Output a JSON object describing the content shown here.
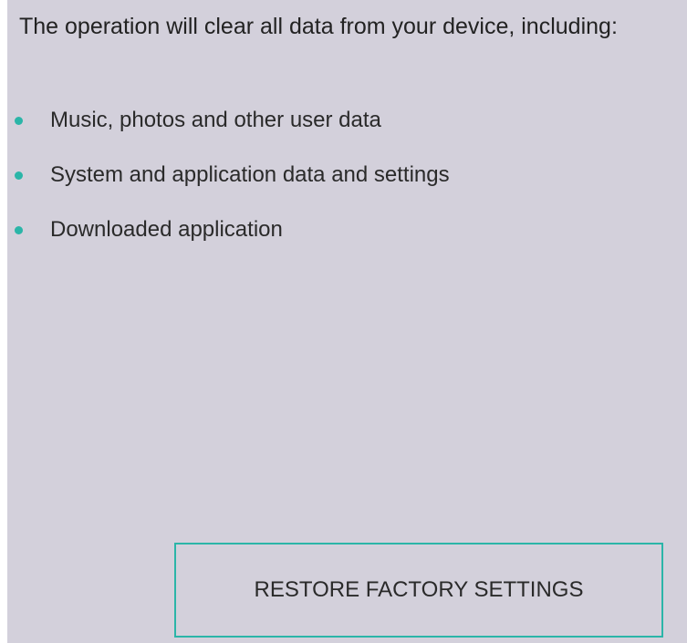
{
  "message": "The operation will clear all data from your device, including:",
  "items": [
    {
      "label": "Music, photos and other user data",
      "icon": "bullet-dot-icon"
    },
    {
      "label": "System and application data and settings",
      "icon": "bullet-dot-icon"
    },
    {
      "label": "Downloaded application",
      "icon": "bullet-dot-icon"
    }
  ],
  "restore_button": {
    "label": "RESTORE FACTORY SETTINGS"
  },
  "colors": {
    "background": "#d3d0db",
    "accent": "#2bb5a8",
    "text": "#222222"
  }
}
